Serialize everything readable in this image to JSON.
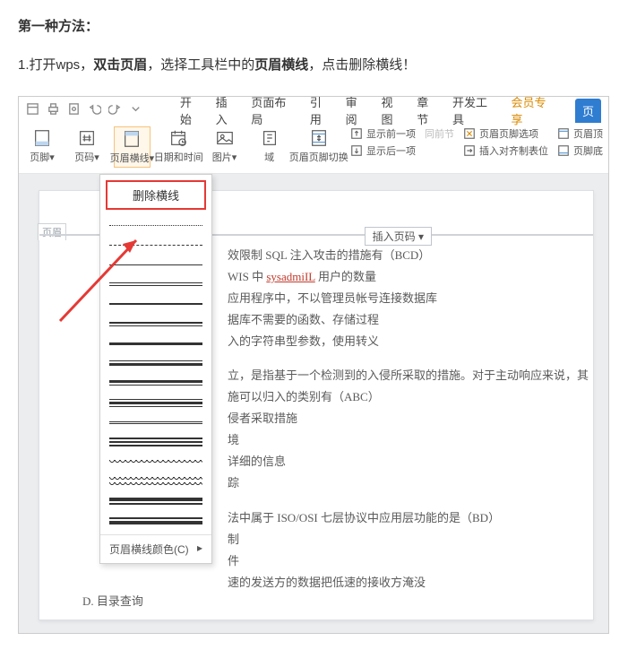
{
  "article": {
    "title": "第一种方法：",
    "step_prefix": "1.打开wps，",
    "step_bold1": "双击页眉",
    "step_mid": "，选择工具栏中的",
    "step_bold2": "页眉横线",
    "step_suffix": "，点击删除横线！"
  },
  "tabs": {
    "items": [
      "开始",
      "插入",
      "页面布局",
      "引用",
      "审阅",
      "视图",
      "章节",
      "开发工具"
    ],
    "vip": "会员专享",
    "active": "页"
  },
  "ribbon": {
    "footer": "页脚▾",
    "pagenum": "页码▾",
    "headerline": "页眉横线▾",
    "datetime": "日期和时间",
    "picture": "图片▾",
    "field": "域",
    "switch": "页眉页脚切换",
    "show_prev": "显示前一项",
    "show_next": "显示后一项",
    "same_prev": "同前节",
    "hf_options": "页眉页脚选项",
    "insert_tab": "插入对齐制表位",
    "header_top": "页眉顶",
    "footer_bot": "页脚底"
  },
  "dropdown": {
    "delete": "删除横线",
    "footer": "页眉横线颜色(C)"
  },
  "doc": {
    "header_tag": "页眉",
    "insert_pagenum": "插入页码 ▾",
    "lines": [
      "效限制 SQL 注入攻击的措施有（BCD）",
      "WIS 中 <u>sysadmiIL</u> 用户的数量",
      "应用程序中，不以管理员帐号连接数据库",
      "据库不需要的函数、存储过程",
      "入的字符串型参数，使用转义",
      "",
      "立，是指基于一个检测到的入侵所采取的措施。对于主动响应来说，其",
      "施可以归入的类别有（ABC）",
      "侵者采取措施",
      "境",
      "详细的信息",
      "踪",
      "",
      "法中属于 ISO/OSI 七层协议中应用层功能的是（BD）",
      "制",
      "件",
      "速的发送方的数据把低速的接收方淹没"
    ],
    "bottom": "D. 目录查询"
  }
}
